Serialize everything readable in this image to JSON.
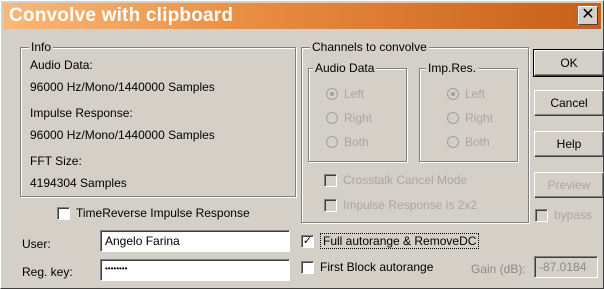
{
  "window": {
    "title": "Convolve with clipboard",
    "close_glyph": "✕"
  },
  "info": {
    "group_label": "Info",
    "audio_data_label": "Audio Data:",
    "audio_data_value": "96000 Hz/Mono/1440000 Samples",
    "impulse_label": "Impulse Response:",
    "impulse_value": "96000 Hz/Mono/1440000 Samples",
    "fft_label": "FFT Size:",
    "fft_value": "4194304 Samples"
  },
  "channels": {
    "group_label": "Channels to convolve",
    "audio_data": {
      "label": "Audio Data",
      "options": [
        "Left",
        "Right",
        "Both"
      ],
      "selected": "Left"
    },
    "imp_res": {
      "label": "Imp.Res.",
      "options": [
        "Left",
        "Right",
        "Both"
      ],
      "selected": "Left"
    },
    "crosstalk_label": "Crosstalk Cancel Mode",
    "impulse2x2_label": "Impulse Response is 2x2"
  },
  "buttons": {
    "ok": "OK",
    "cancel": "Cancel",
    "help": "Help",
    "preview": "Preview",
    "bypass_label": "bypass"
  },
  "timereverse_label": "TimeReverse Impulse Response",
  "user": {
    "label": "User:",
    "value": "Angelo Farina"
  },
  "regkey": {
    "label": "Reg. key:",
    "value": "••••••••"
  },
  "full_autorange": {
    "label": "Full autorange & RemoveDC",
    "checked": true,
    "mark": "✓"
  },
  "first_block": {
    "label": "First Block autorange",
    "checked": false
  },
  "gain": {
    "label": "Gain (dB):",
    "value": "-87.0184"
  }
}
